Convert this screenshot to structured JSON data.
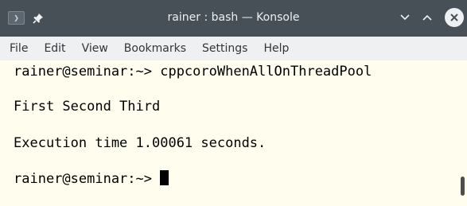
{
  "window": {
    "title": "rainer : bash — Konsole",
    "terminal_icon_glyph": "❯",
    "icons": [
      "terminal-icon",
      "pin-icon",
      "minimize-icon",
      "maximize-icon",
      "close-icon"
    ]
  },
  "menu": {
    "items": [
      "File",
      "Edit",
      "View",
      "Bookmarks",
      "Settings",
      "Help"
    ]
  },
  "terminal": {
    "lines": [
      "rainer@seminar:~> cppcoroWhenAllOnThreadPool",
      "First Second Third",
      "Execution time 1.00061 seconds.",
      "rainer@seminar:~> "
    ],
    "colors": {
      "background": "#fefdee",
      "foreground": "#000000"
    }
  },
  "colors": {
    "titlebar": "#475057",
    "menubar": "#eff0f1"
  }
}
